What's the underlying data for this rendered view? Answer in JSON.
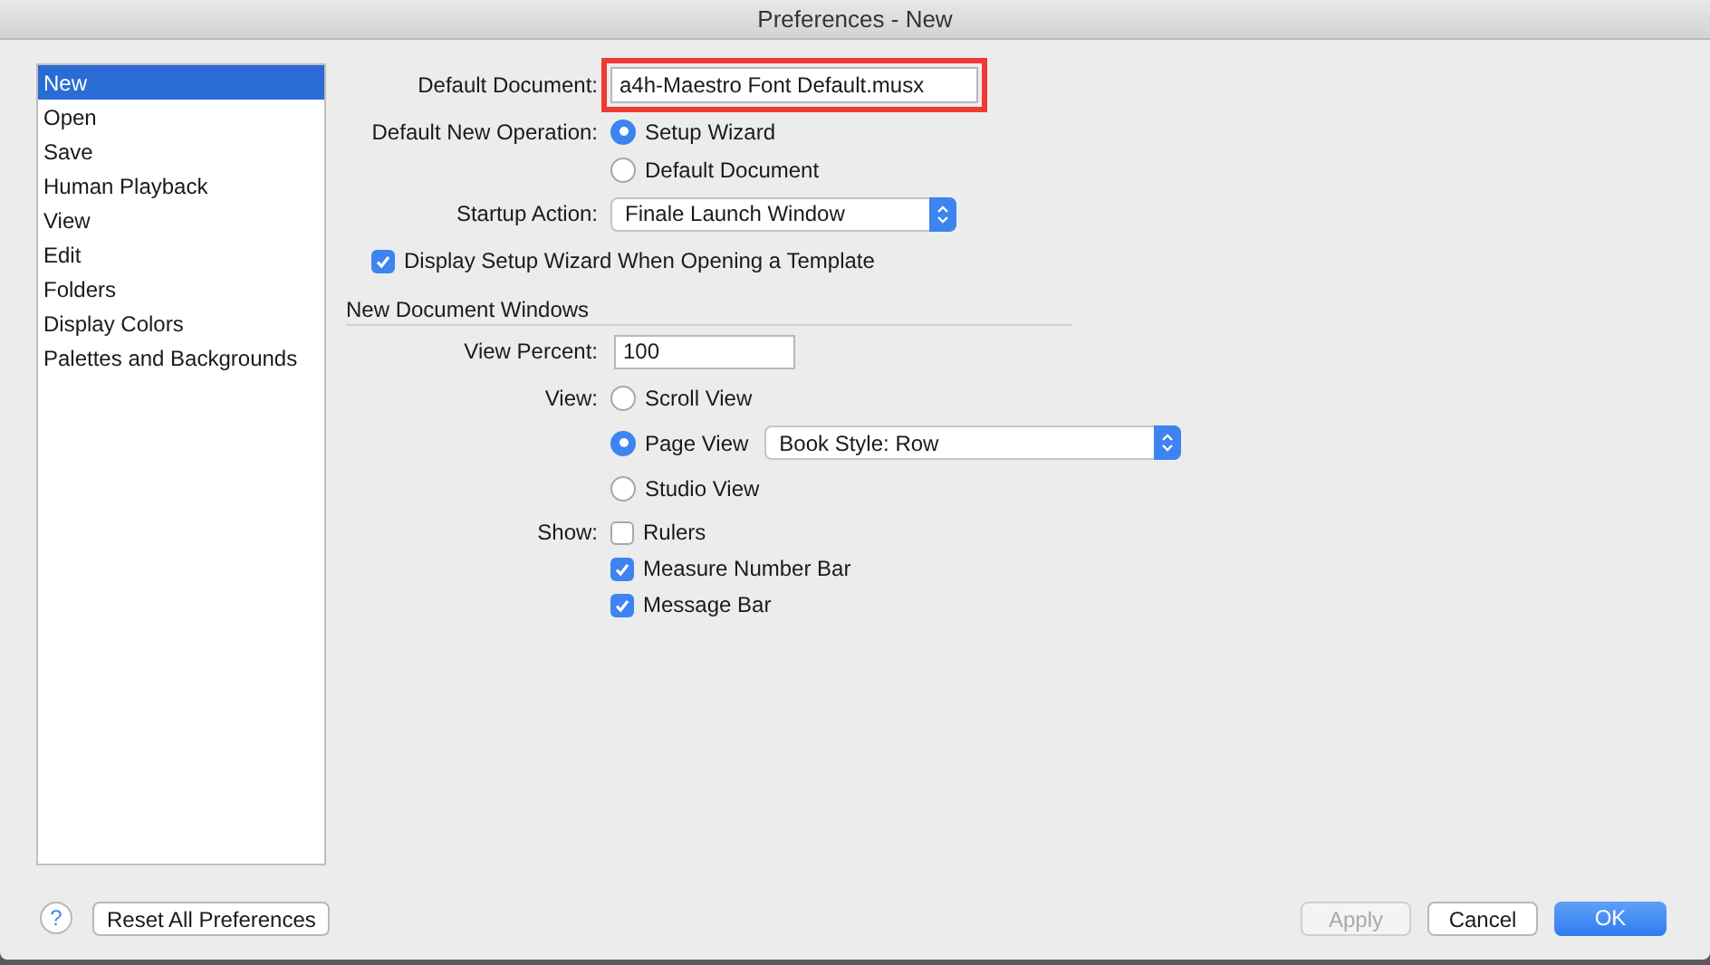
{
  "window": {
    "title": "Preferences - New"
  },
  "sidebar": {
    "items": [
      {
        "label": "New",
        "selected": true
      },
      {
        "label": "Open",
        "selected": false
      },
      {
        "label": "Save",
        "selected": false
      },
      {
        "label": "Human Playback",
        "selected": false
      },
      {
        "label": "View",
        "selected": false
      },
      {
        "label": "Edit",
        "selected": false
      },
      {
        "label": "Folders",
        "selected": false
      },
      {
        "label": "Display Colors",
        "selected": false
      },
      {
        "label": "Palettes and Backgrounds",
        "selected": false
      }
    ]
  },
  "default_document": {
    "label": "Default Document:",
    "value": "a4h-Maestro Font Default.musx",
    "highlighted": true
  },
  "default_new_operation": {
    "label": "Default New Operation:",
    "options": [
      {
        "label": "Setup Wizard",
        "selected": true
      },
      {
        "label": "Default Document",
        "selected": false
      }
    ]
  },
  "startup_action": {
    "label": "Startup Action:",
    "value": "Finale Launch Window"
  },
  "display_setup_wizard": {
    "label": "Display Setup Wizard When Opening a Template",
    "checked": true
  },
  "new_document_windows": {
    "title": "New Document Windows",
    "view_percent": {
      "label": "View Percent:",
      "value": "100"
    },
    "view": {
      "label": "View:",
      "options": [
        {
          "label": "Scroll View",
          "selected": false
        },
        {
          "label": "Page View",
          "selected": true,
          "popup": "Book Style: Row"
        },
        {
          "label": "Studio View",
          "selected": false
        }
      ]
    },
    "show": {
      "label": "Show:",
      "options": [
        {
          "label": "Rulers",
          "checked": false
        },
        {
          "label": "Measure Number Bar",
          "checked": true
        },
        {
          "label": "Message Bar",
          "checked": true
        }
      ]
    }
  },
  "footer": {
    "help": "?",
    "reset_button": "Reset All Preferences",
    "buttons": [
      {
        "label": "Apply",
        "kind": "normal",
        "disabled": true
      },
      {
        "label": "Cancel",
        "kind": "normal",
        "disabled": false
      },
      {
        "label": "OK",
        "kind": "primary",
        "disabled": false
      }
    ]
  }
}
